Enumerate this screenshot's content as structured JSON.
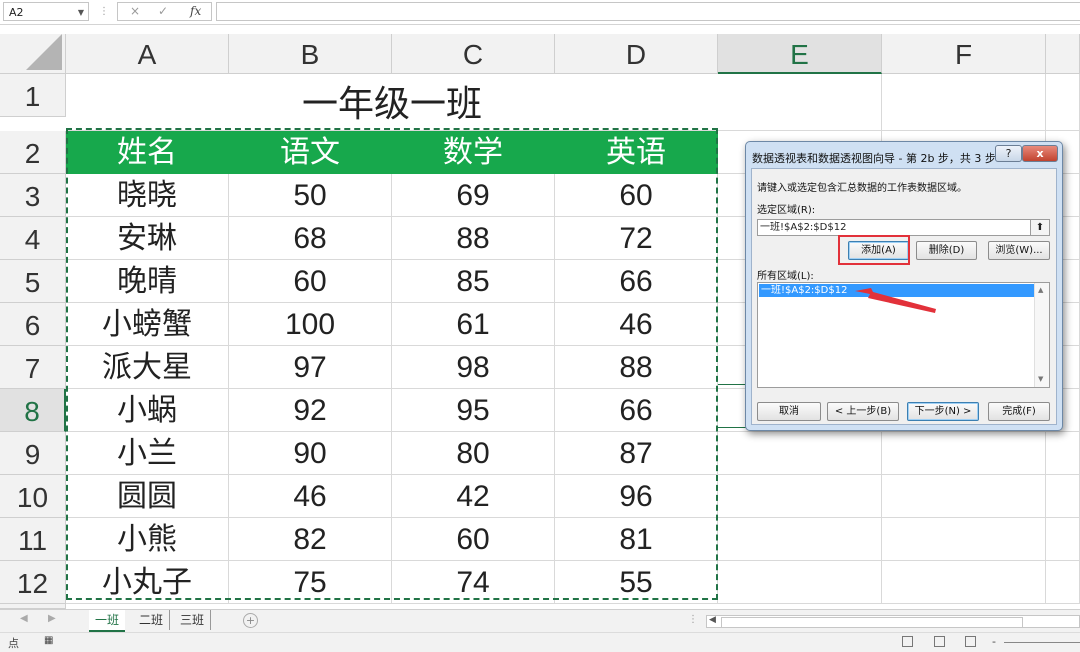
{
  "formula_bar": {
    "name_box": "A2",
    "cancel_icon": "×",
    "enter_icon": "✓",
    "fx_icon": "fx",
    "formula": ""
  },
  "columns": [
    "A",
    "B",
    "C",
    "D",
    "E",
    "F"
  ],
  "rows": [
    "1",
    "2",
    "3",
    "4",
    "5",
    "6",
    "7",
    "8",
    "9",
    "10",
    "11",
    "12"
  ],
  "sheet": {
    "title": "一年级一班",
    "headers": [
      "姓名",
      "语文",
      "数学",
      "英语"
    ],
    "header_color": "#17a84c",
    "data": [
      [
        "晓晓",
        "50",
        "69",
        "60"
      ],
      [
        "安琳",
        "68",
        "88",
        "72"
      ],
      [
        "晚晴",
        "60",
        "85",
        "66"
      ],
      [
        "小螃蟹",
        "100",
        "61",
        "46"
      ],
      [
        "派大星",
        "97",
        "98",
        "88"
      ],
      [
        "小蜗",
        "92",
        "95",
        "66"
      ],
      [
        "小兰",
        "90",
        "80",
        "87"
      ],
      [
        "圆圆",
        "46",
        "42",
        "96"
      ],
      [
        "小熊",
        "82",
        "60",
        "81"
      ],
      [
        "小丸子",
        "75",
        "74",
        "55"
      ]
    ]
  },
  "sheet_tabs": [
    "一班",
    "二班",
    "三班"
  ],
  "status": {
    "mode": "点",
    "zoom_minus": "-"
  },
  "dialog": {
    "title": "数据透视表和数据透视图向导 - 第 2b 步，共 3 步",
    "help_label": "?",
    "close_label": "x",
    "instruction": "请键入或选定包含汇总数据的工作表数据区域。",
    "range_label": "选定区域(R):",
    "range_value": "一班!$A$2:$D$12",
    "add_button": "添加(A)",
    "delete_button": "删除(D)",
    "browse_button": "浏览(W)...",
    "all_ranges_label": "所有区域(L):",
    "all_ranges": [
      "一班!$A$2:$D$12"
    ],
    "cancel_button": "取消",
    "back_button": "< 上一步(B)",
    "next_button": "下一步(N) >",
    "finish_button": "完成(F)",
    "highlight_color": "#e2313a"
  }
}
